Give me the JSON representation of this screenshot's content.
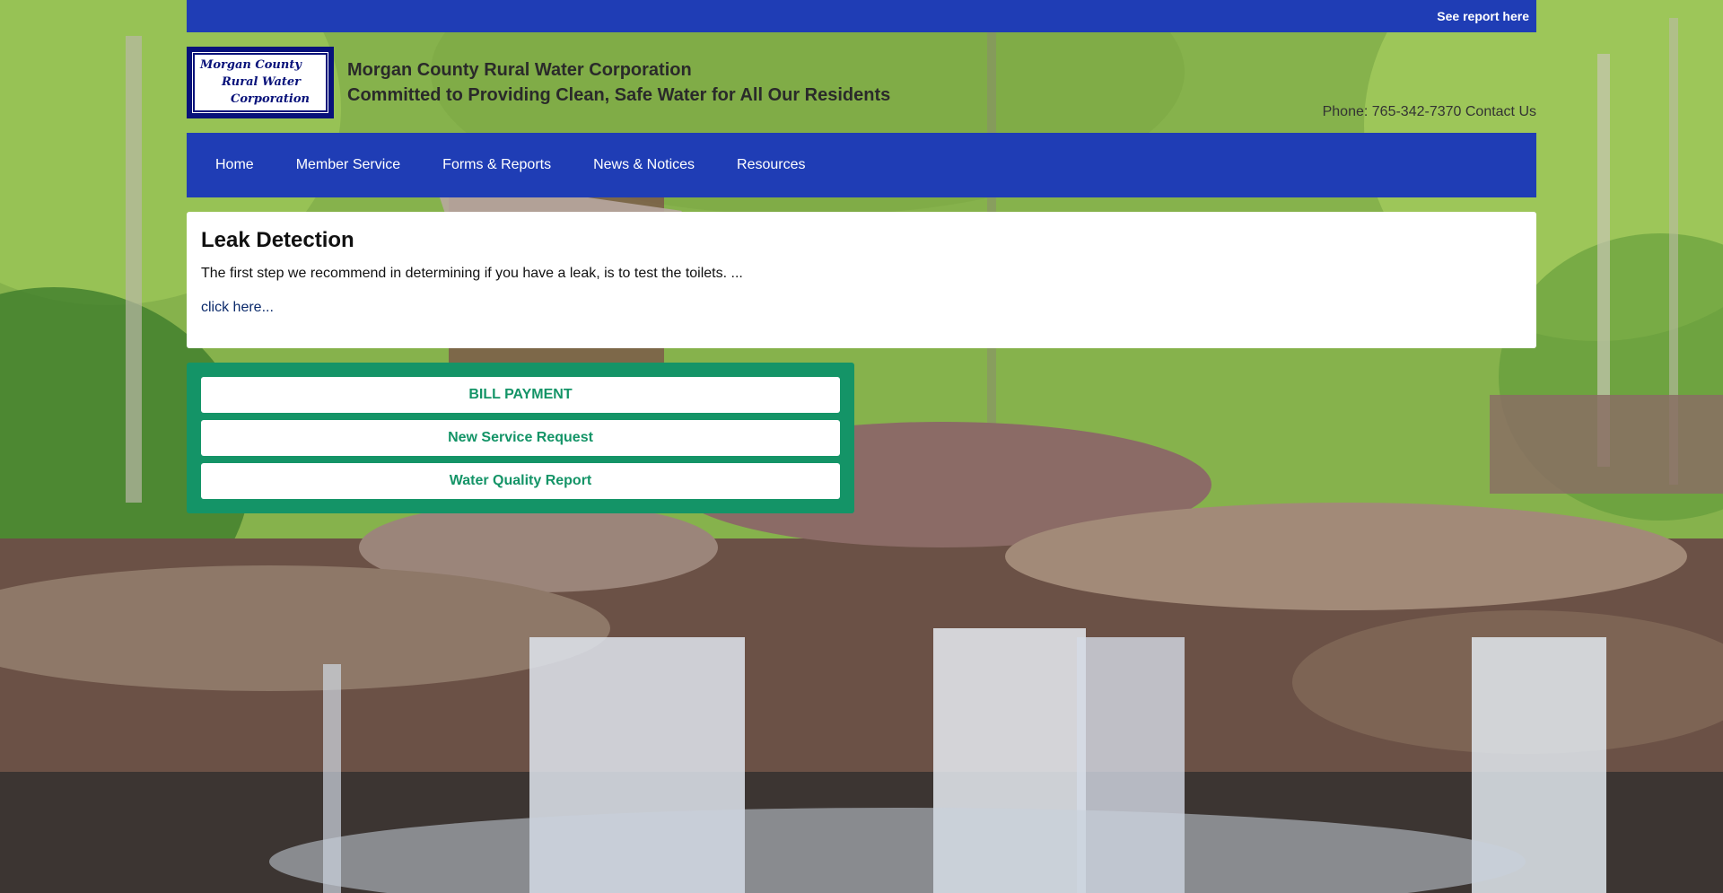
{
  "topbar": {
    "link": "See report here"
  },
  "header": {
    "logo_text": [
      "Morgan County",
      "Rural Water",
      "Corporation"
    ],
    "title": "Morgan County Rural Water Corporation",
    "subtitle": "Committed to Providing Clean, Safe Water for All Our Residents",
    "phone": "Phone: 765-342-7370",
    "contact_link": "Contact Us"
  },
  "nav": {
    "items": [
      "Home",
      "Member Service",
      "Forms & Reports",
      "News & Notices",
      "Resources"
    ]
  },
  "article": {
    "title": "Leak Detection",
    "text": "The first step we recommend in determining if you have a leak, is to test the toilets. ...",
    "link": "click here..."
  },
  "actions": [
    "BILL PAYMENT",
    "New Service Request",
    "Water Quality Report"
  ],
  "colors": {
    "primary_blue": "#1f3db5",
    "action_green": "#149467"
  },
  "background": "waterfall-forest-photo"
}
